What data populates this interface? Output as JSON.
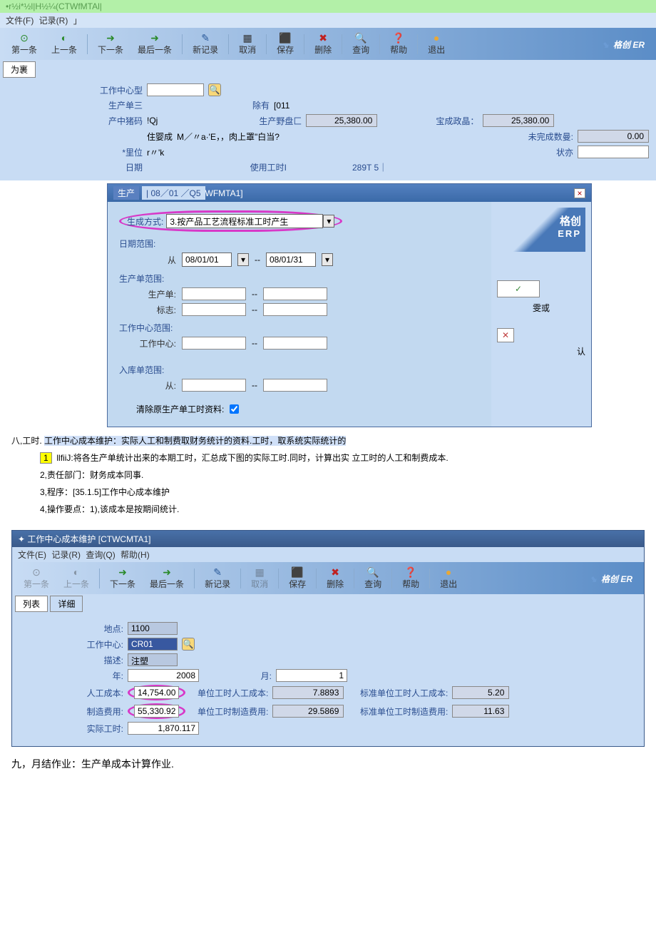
{
  "app": {
    "titleBar": "•r½i*½l|H½¼(CTWfMTAl|",
    "menu": {
      "file": "文件(F)",
      "record": "记录(R)",
      "more": "」"
    },
    "brand": "格创 ER",
    "brandFull": "格创",
    "brandSub": "ERP"
  },
  "toolbar": {
    "first": "第一条",
    "prev": "上一条",
    "next": "下一条",
    "last": "最后一条",
    "new": "新记录",
    "cancel": "取消",
    "save": "保存",
    "delete": "删除",
    "query": "查询",
    "help": "帮助",
    "exit": "退出"
  },
  "tab": {
    "weiBiao": "为裹"
  },
  "form1": {
    "workCenterType": "工作中心型",
    "prodOrder": "生产单三",
    "prodCode": "产中猪码",
    "prodCodeVal": "!Qj",
    "chuyou": "除有",
    "chuyouVal": "[011",
    "prodYe": "生产野盘匚",
    "prodYeVal": "25,380.00",
    "jiaoxiu": "宝成政晶：",
    "jiaoxiuVal": "25,380.00",
    "zhuying": "住婴成",
    "zhuyingVal": "M／〃a·'E，，肉上罩\"白当?",
    "weiwancheng": "未完成数曼:",
    "weiwanchengVal": "0.00",
    "liwei": "*里位",
    "liweiVal": "r〃'k",
    "zhuangtai": "状亦",
    "riqi": "日期",
    "riqiVal": "| 08／01 ／Q5",
    "shiyong": "使用工时I",
    "shiyongVal": "289T 5｜"
  },
  "dialog": {
    "titleCode": "WFMTA1]",
    "titleTab": "生产",
    "method": {
      "label": "生成方式:",
      "value": "3.按产品工艺流程标准工时产生"
    },
    "dateRange": {
      "label": "日期范围:",
      "from": "从",
      "fromVal": "08/01/01",
      "sep": "--",
      "toVal": "08/01/31"
    },
    "prodRange": {
      "label": "生产单范围:",
      "order": "生产单:",
      "flag": "标志:"
    },
    "wcRange": {
      "label": "工作中心范围:",
      "wc": "工作中心:"
    },
    "stockRange": {
      "label": "入库单范围:",
      "from": "从:"
    },
    "clear": "清除原生产单工时资料:",
    "btnOk": "雯或",
    "btnCancel": "ⅹ",
    "btnMore": "认"
  },
  "doc": {
    "sec8": "八,工时.",
    "p0": "工作中心成本维护：实际人工和制费取财务统计的资料.工时，取系统实际统计的",
    "p1num": "1",
    "p1": "llfiiJ:将各生产单统计出来的本期工时，汇总成下图的实际工时.同时，计算出实 立工时的人工和制费成本.",
    "p2": "2,责任部门：财务成本同事.",
    "p3": "3,程序：[35.1.5]工作中心成本维护",
    "p4": "4,操作要点：1),该成本是按期间统计.",
    "sec9": "九，月结作业：生产单成本计算作业."
  },
  "win2": {
    "title": "工作中心成本维护 [CTWCMTA1]",
    "menu": {
      "file": "文件(E)",
      "record": "记录(R)",
      "query": "查询(Q)",
      "help": "帮助(H)"
    },
    "tabs": {
      "list": "列表",
      "detail": "详细"
    },
    "fields": {
      "didian": "地点:",
      "didianVal": "1100",
      "wc": "工作中心:",
      "wcVal": "CR01",
      "desc": "描述:",
      "descVal": "注塑",
      "year": "年:",
      "yearVal": "2008",
      "month": "月:",
      "monthVal": "1",
      "labor": "人工成本:",
      "laborVal": "14,754.00",
      "unitLabor": "单位工时人工成本:",
      "unitLaborVal": "7.8893",
      "stdUnitLabor": "标准单位工时人工成本:",
      "stdUnitLaborVal": "5.20",
      "mfg": "制造费用:",
      "mfgVal": "55,330.92",
      "unitMfg": "单位工时制造费用:",
      "unitMfgVal": "29.5869",
      "stdUnitMfg": "标准单位工时制造费用:",
      "stdUnitMfgVal": "11.63",
      "actual": "实际工时:",
      "actualVal": "1,870.117"
    }
  }
}
